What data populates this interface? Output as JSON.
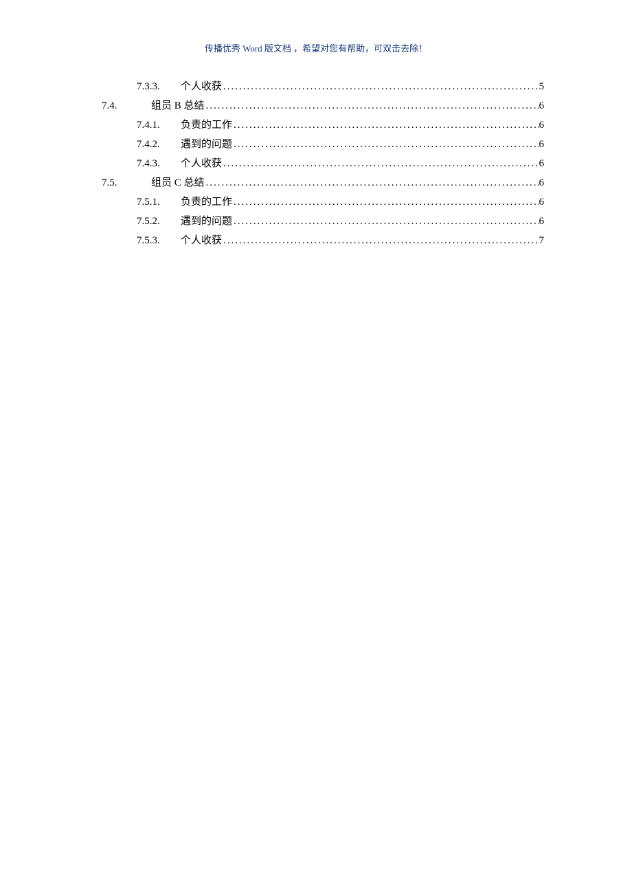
{
  "header": {
    "text": "传播优秀 Word 版文档 ，希望对您有帮助，可双击去除！"
  },
  "toc": {
    "entries": [
      {
        "level": 2,
        "number": "7.3.3.",
        "title": "个人收获",
        "page": "5"
      },
      {
        "level": 1,
        "number": "7.4.",
        "title": "组员 B 总结",
        "page": "6"
      },
      {
        "level": 2,
        "number": "7.4.1.",
        "title": "负责的工作",
        "page": "6"
      },
      {
        "level": 2,
        "number": "7.4.2.",
        "title": "遇到的问题",
        "page": "6"
      },
      {
        "level": 2,
        "number": "7.4.3.",
        "title": "个人收获",
        "page": "6"
      },
      {
        "level": 1,
        "number": "7.5.",
        "title": "组员 C 总结",
        "page": "6"
      },
      {
        "level": 2,
        "number": "7.5.1.",
        "title": "负责的工作",
        "page": "6"
      },
      {
        "level": 2,
        "number": "7.5.2.",
        "title": "遇到的问题",
        "page": "6"
      },
      {
        "level": 2,
        "number": "7.5.3.",
        "title": "个人收获",
        "page": "7"
      }
    ]
  },
  "dots": "................................................................................................................................................................................................"
}
